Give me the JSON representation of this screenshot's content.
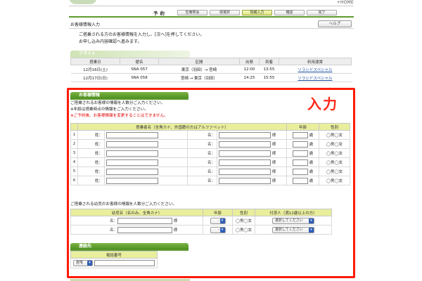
{
  "header": {
    "home_link": "+HOME"
  },
  "steps": {
    "heading": "予約",
    "items": [
      "空席照会",
      "便選択",
      "情報入力",
      "確認",
      "完了"
    ],
    "active_index": 2
  },
  "page_title": "お客様情報入力",
  "help_button": "ヘルプ",
  "intro": {
    "line1": "ご搭乗される方のお客様情報を入力し、[次へ]を押してください。",
    "line2": "お申し込み内容確認へ進みます。"
  },
  "flight_section": {
    "label": "フライト",
    "columns": [
      "搭乗日",
      "便名",
      "区間",
      "出発",
      "到着",
      "利用運賃"
    ],
    "rows": [
      {
        "date": "12月16日(土)",
        "flight": "SNA 057",
        "route": "東京（羽田）→ 宮崎",
        "depart": "12:00",
        "arrive": "13:55",
        "fare": "ソラシドスペシャル"
      },
      {
        "date": "12月17日(日)",
        "flight": "SNA 058",
        "route": "宮崎 → 東京（羽田）",
        "depart": "14:25",
        "arrive": "15:55",
        "fare": "ソラシドスペシャル"
      }
    ]
  },
  "annotation": {
    "label": "入力"
  },
  "passenger_section": {
    "label": "お客様情報",
    "note1": "ご搭乗されるお客様の情報を人数分ご入力ください。",
    "note2": "※年齢は搭乗時点の情報をご入力ください。",
    "note3": "※ご予約後、お客様情報を変更することはできません。",
    "col_name": "搭乗者名（全角カナ、外国籍の方はアルファベット）",
    "col_age": "年齢",
    "col_gender": "性別",
    "last_name_label": "姓：",
    "first_name_label": "名：",
    "honorific": "様",
    "age_unit": "歳",
    "gender_options": "◯男◯女",
    "row_numbers": [
      "1",
      "2",
      "3",
      "4",
      "5",
      "6"
    ]
  },
  "infant_section": {
    "note": "ご搭乗される幼児のお客様の情報を人数分ご入力ください。",
    "col_name": "幼児名（名のみ、全角カナ）",
    "col_age": "年齢",
    "col_gender": "性別",
    "col_guardian": "付添人（満12歳以上の方）",
    "first_name_label": "名：",
    "honorific": "様",
    "age_select": "-",
    "gender_options": "◯男◯女",
    "guardian_select": "選択してください",
    "row_count": 2
  },
  "contact_section": {
    "label": "連絡先",
    "col_phone": "電話番号",
    "phone_type": "自宅"
  },
  "colors": {
    "accent_green": "#5c9a2e",
    "highlight_red": "#ff1a00",
    "header_yellow": "#e9ee9c"
  }
}
